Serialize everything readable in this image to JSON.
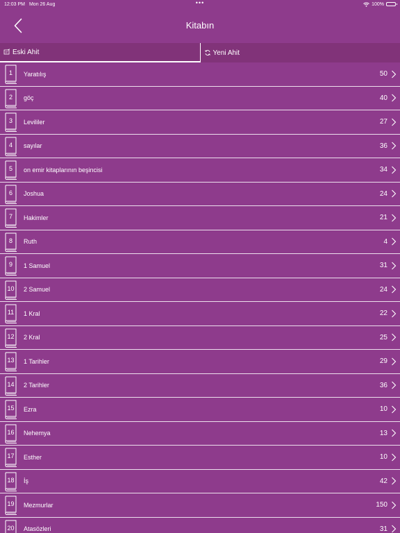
{
  "status": {
    "time": "12:03 PM",
    "date": "Mon 26 Aug",
    "dots": "•••",
    "battery": "100%"
  },
  "header": {
    "title": "Kitabın"
  },
  "tabs": [
    {
      "label": "Eski Ahit"
    },
    {
      "label": "Yeni Ahit"
    }
  ],
  "books": [
    {
      "num": "1",
      "name": "Yaratılış",
      "count": "50"
    },
    {
      "num": "2",
      "name": "göç",
      "count": "40"
    },
    {
      "num": "3",
      "name": "Levililer",
      "count": "27"
    },
    {
      "num": "4",
      "name": "sayılar",
      "count": "36"
    },
    {
      "num": "5",
      "name": "on emir kitaplarının beşincisi",
      "count": "34"
    },
    {
      "num": "6",
      "name": "Joshua",
      "count": "24"
    },
    {
      "num": "7",
      "name": "Hakimler",
      "count": "21"
    },
    {
      "num": "8",
      "name": "Ruth",
      "count": "4"
    },
    {
      "num": "9",
      "name": "1 Samuel",
      "count": "31"
    },
    {
      "num": "10",
      "name": "2 Samuel",
      "count": "24"
    },
    {
      "num": "11",
      "name": "1 Kral",
      "count": "22"
    },
    {
      "num": "12",
      "name": "2 Kral",
      "count": "25"
    },
    {
      "num": "13",
      "name": "1 Tarihler",
      "count": "29"
    },
    {
      "num": "14",
      "name": "2 Tarihler",
      "count": "36"
    },
    {
      "num": "15",
      "name": "Ezra",
      "count": "10"
    },
    {
      "num": "16",
      "name": "Nehemya",
      "count": "13"
    },
    {
      "num": "17",
      "name": "Esther",
      "count": "10"
    },
    {
      "num": "18",
      "name": "İş",
      "count": "42"
    },
    {
      "num": "19",
      "name": "Mezmurlar",
      "count": "150"
    },
    {
      "num": "20",
      "name": "Atasözleri",
      "count": "31"
    }
  ]
}
